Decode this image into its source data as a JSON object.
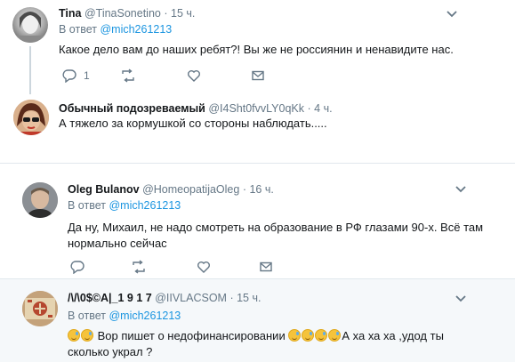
{
  "tweets": [
    {
      "name": "Tina",
      "handle": "@TinaSonetino",
      "dot": "·",
      "time": "15 ч.",
      "reply_prefix": "В ответ",
      "reply_to": "@mich261213",
      "text": "Какое дело вам до наших ребят?! Вы же не россиянин и ненавидите нас.",
      "reply_count": "1"
    },
    {
      "name": "Обычный подозреваемый",
      "handle": "@I4Sht0fvvLY0qKk",
      "dot": "·",
      "time": "4 ч.",
      "text": "А тяжело за кормушкой со стороны наблюдать....."
    },
    {
      "name": "Oleg Bulanov",
      "handle": "@HomeopatijaOleg",
      "dot": "·",
      "time": "16 ч.",
      "reply_prefix": "В ответ",
      "reply_to": "@mich261213",
      "text_line1": "Да ну, Михаил, не надо смотреть на образование в РФ глазами 90-х. Всё там",
      "text_line2": "нормально сейчас"
    },
    {
      "name": "/\\/\\0$©A|_1  9  1  7",
      "handle": "@IIVLACSOM",
      "dot": "·",
      "time": "15 ч.",
      "reply_prefix": "В ответ",
      "reply_to": "@mich261213",
      "text_part1": "Вор пишет о недофинансировании",
      "text_part2": "А ха ха ха ,удод ты",
      "text_line2": "сколько украл ?"
    }
  ],
  "colors": {
    "text": "#14171a",
    "secondary": "#657786",
    "link": "#1b95e0",
    "highlight_bg": "#f5f8fa",
    "thread_line": "#ccd6dd",
    "divider": "#e1e8ed"
  },
  "icons": [
    "chevron-down-icon",
    "reply-icon",
    "retweet-icon",
    "like-icon",
    "message-icon",
    "face-with-tears-of-joy-emoji"
  ]
}
